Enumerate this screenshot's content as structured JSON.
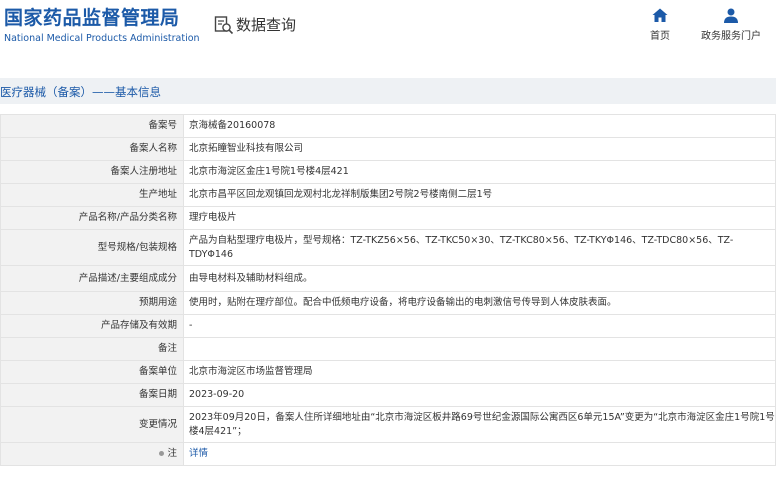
{
  "header": {
    "logo_cn": "国家药品监督管理局",
    "logo_en": "National Medical Products Administration",
    "search_title": "数据查询",
    "nav_home": "首页",
    "nav_portal": "政务服务门户"
  },
  "breadcrumb": "医疗器械（备案）——基本信息",
  "colors": {
    "brand": "#1c5aa8",
    "label_bg": "#f2f2f2",
    "subbar_bg": "#eef1f4"
  },
  "rows": {
    "r1": {
      "label": "备案号",
      "value": "京海械备20160078"
    },
    "r2": {
      "label": "备案人名称",
      "value": "北京拓瞳智业科技有限公司"
    },
    "r3": {
      "label": "备案人注册地址",
      "value": "北京市海淀区金庄1号院1号楼4层421"
    },
    "r4": {
      "label": "生产地址",
      "value": "北京市昌平区回龙观镇回龙观村北龙祥制版集团2号院2号楼南侧二层1号"
    },
    "r5": {
      "label": "产品名称/产品分类名称",
      "value": "理疗电极片"
    },
    "r6": {
      "label": "型号规格/包装规格",
      "value": "产品为自粘型理疗电极片，型号规格：TZ-TKZ56×56、TZ-TKC50×30、TZ-TKC80×56、TZ-TKYΦ146、TZ-TDC80×56、TZ-TDYΦ146"
    },
    "r7": {
      "label": "产品描述/主要组成成分",
      "value": "由导电材料及辅助材料组成。"
    },
    "r8": {
      "label": "预期用途",
      "value": "使用时，贴附在理疗部位。配合中低频电疗设备，将电疗设备输出的电刺激信号传导到人体皮肤表面。"
    },
    "r9": {
      "label": "产品存储及有效期",
      "value": "-"
    },
    "r10": {
      "label": "备注",
      "value": ""
    },
    "r11": {
      "label": "备案单位",
      "value": "北京市海淀区市场监督管理局"
    },
    "r12": {
      "label": "备案日期",
      "value": "2023-09-20"
    },
    "r13": {
      "label": "变更情况",
      "value": "2023年09月20日，备案人住所详细地址由“北京市海淀区板井路69号世纪金源国际公寓西区6单元15A”变更为“北京市海淀区金庄1号院1号楼4层421”；"
    },
    "r14": {
      "label": "注",
      "value": "详情"
    }
  }
}
